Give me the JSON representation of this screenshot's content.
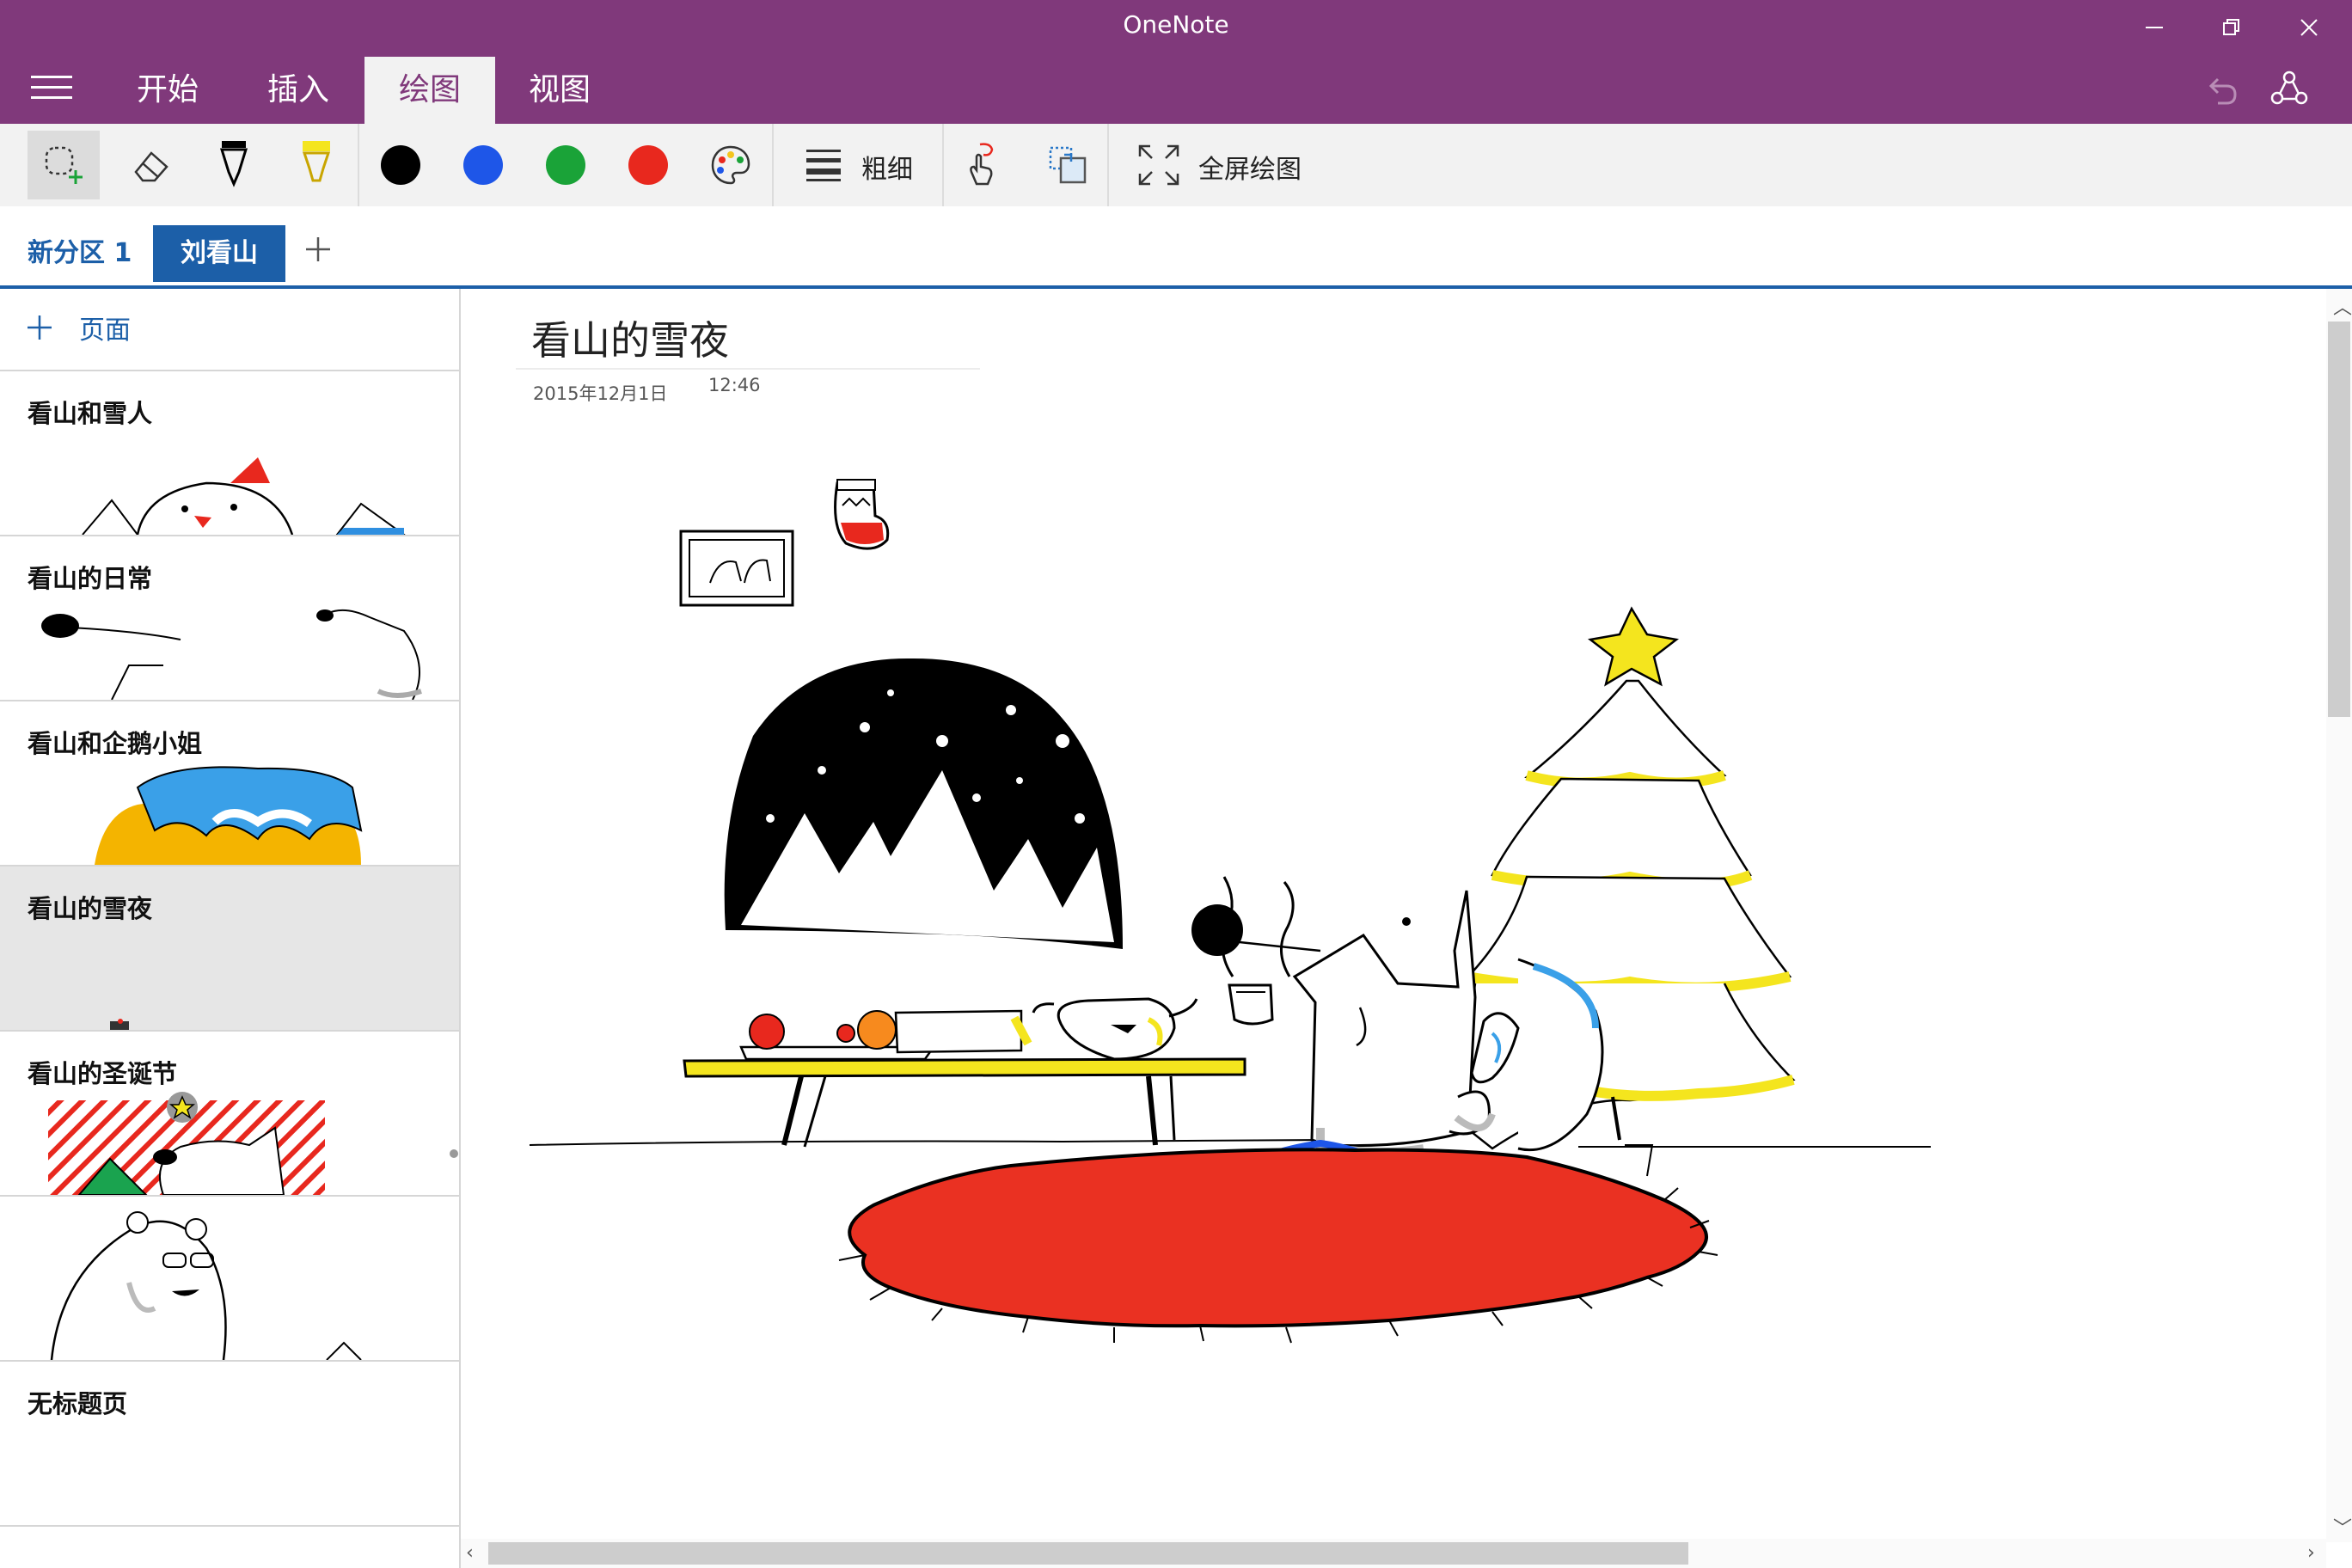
{
  "app": {
    "title": "OneNote",
    "accent": "#80397b",
    "link_color": "#1c5fa8",
    "window_controls": [
      "minimize-icon",
      "restore-icon",
      "close-icon"
    ]
  },
  "ribbon": {
    "tabs": [
      {
        "label": "开始",
        "active": false
      },
      {
        "label": "插入",
        "active": false
      },
      {
        "label": "绘图",
        "active": true
      },
      {
        "label": "视图",
        "active": false
      }
    ],
    "right_icons": [
      "undo-icon",
      "share-icon"
    ]
  },
  "toolbar": {
    "tools": [
      "lasso-select-icon",
      "eraser-icon",
      "pen-icon",
      "highlighter-icon"
    ],
    "colors": [
      "#000000",
      "#1e56e8",
      "#1aa338",
      "#e8281e"
    ],
    "palette_icon": "color-palette-icon",
    "thickness_label": "粗细",
    "convert_icons": [
      "ink-to-text-icon",
      "ink-to-shape-icon"
    ],
    "fullscreen_label": "全屏绘图"
  },
  "sections": {
    "tabs": [
      {
        "label": "新分区 1",
        "active": false
      },
      {
        "label": "刘看山",
        "active": true
      }
    ]
  },
  "pages": {
    "add_label": "页面",
    "items": [
      {
        "title": "看山和雪人",
        "active": false
      },
      {
        "title": "看山的日常",
        "active": false
      },
      {
        "title": "看山和企鹅小姐",
        "active": false
      },
      {
        "title": "看山的雪夜",
        "active": true
      },
      {
        "title": "看山的圣诞节",
        "active": false
      },
      {
        "title": "",
        "active": false
      },
      {
        "title": "无标题页",
        "active": false
      }
    ]
  },
  "note": {
    "title": "看山的雪夜",
    "date": "2015年12月1日",
    "time": "12:46"
  }
}
